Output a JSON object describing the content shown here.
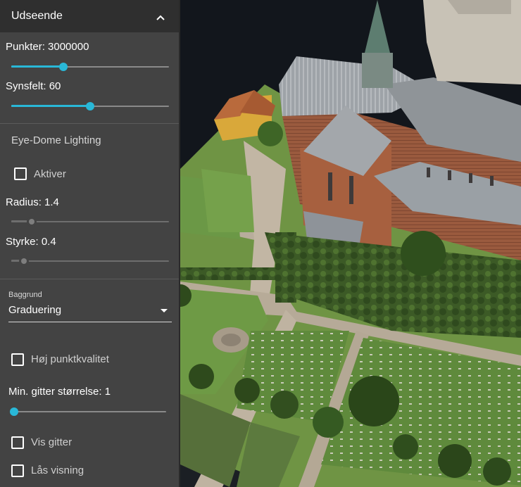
{
  "panel": {
    "title": "Udseende",
    "collapse_icon": "chevron-up-icon",
    "points": {
      "label": "Punkter: 3000000",
      "level": 0.33
    },
    "fov": {
      "label": "Synsfelt: 60",
      "level": 0.5
    },
    "edl": {
      "section_title": "Eye-Dome Lighting",
      "enable_label": "Aktiver",
      "enable_checked": false,
      "radius": {
        "label": "Radius: 1.4",
        "level": 0.13
      },
      "strength": {
        "label": "Styrke: 0.4",
        "level": 0.08
      }
    },
    "background": {
      "caption": "Baggrund",
      "value": "Graduering"
    },
    "high_quality": {
      "label": "Høj punktkvalitet",
      "checked": false
    },
    "min_grid": {
      "label": "Min. gitter størrelse: 1",
      "level": 0.0
    },
    "show_grid": {
      "label": "Vis gitter",
      "checked": false
    },
    "lock_view": {
      "label": "Lås visning",
      "checked": false
    }
  },
  "colors": {
    "accent": "#29b8d8",
    "panel_bg": "#434343",
    "header_bg": "#2f2f2f"
  }
}
